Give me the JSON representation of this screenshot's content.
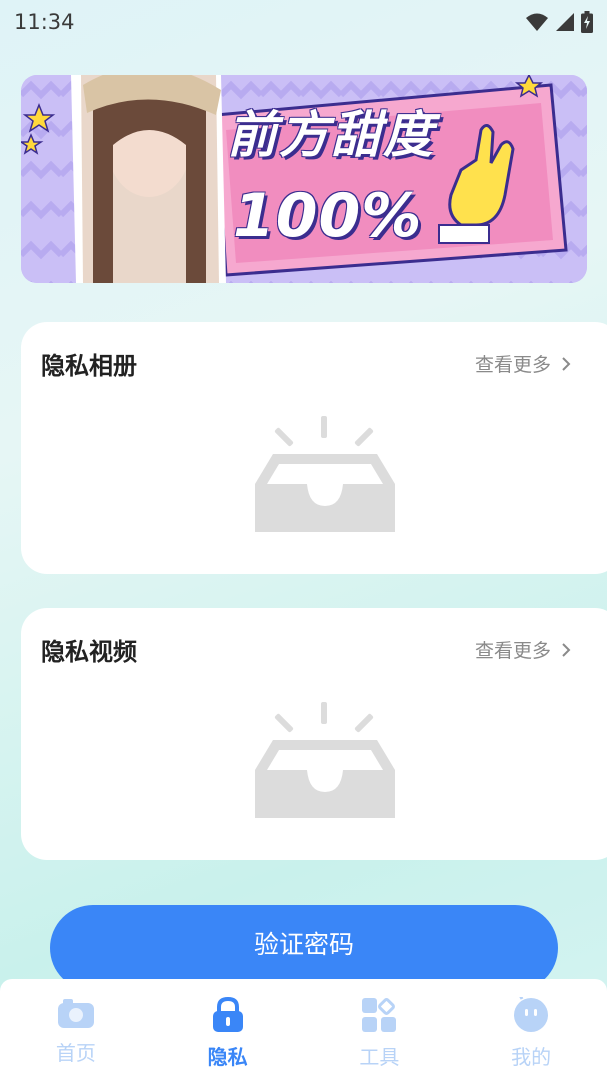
{
  "status_bar": {
    "time": "11:34"
  },
  "banner": {
    "title_line1": "前方甜度",
    "title_line2": "100%"
  },
  "sections": [
    {
      "title": "隐私相册",
      "more_label": "查看更多",
      "icon": "empty-inbox-icon"
    },
    {
      "title": "隐私视频",
      "more_label": "查看更多",
      "icon": "empty-inbox-icon"
    }
  ],
  "verify_button": {
    "label": "验证密码"
  },
  "bottom_nav": {
    "items": [
      {
        "label": "首页",
        "icon": "camera-icon",
        "active": false
      },
      {
        "label": "隐私",
        "icon": "lock-icon",
        "active": true
      },
      {
        "label": "工具",
        "icon": "tools-grid-icon",
        "active": false
      },
      {
        "label": "我的",
        "icon": "profile-face-icon",
        "active": false
      }
    ]
  },
  "colors": {
    "accent": "#3a86f7",
    "inactive_nav": "#b8d3f7",
    "empty_icon": "#dcdcdc"
  }
}
